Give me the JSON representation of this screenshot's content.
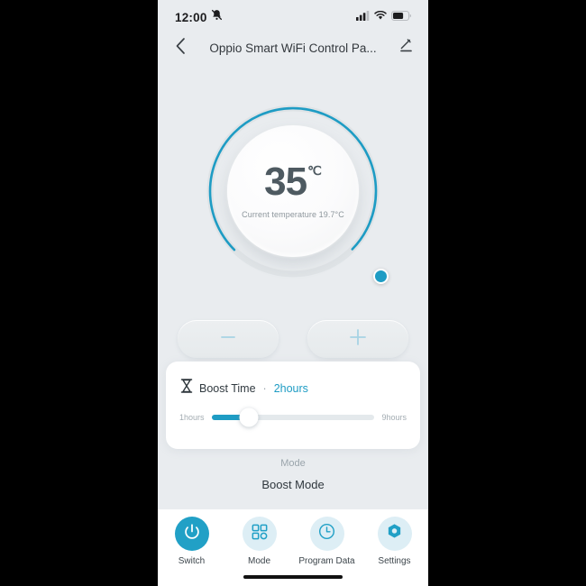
{
  "colors": {
    "accent": "#1e9cc4",
    "nav_active": "#21a0c6",
    "nav_circle": "#ddeef5",
    "background": "#e9ecef",
    "card": "#ffffff",
    "text_dark": "#313a40",
    "text_muted": "#9aa4ab"
  },
  "statusbar": {
    "time": "12:00",
    "mute_icon": "bell-muted-icon",
    "signal_icon": "cellular-signal-icon",
    "wifi_icon": "wifi-icon",
    "battery_icon": "battery-icon",
    "battery_level": 60
  },
  "header": {
    "back_icon": "chevron-left-icon",
    "title": "Oppio Smart WiFi Control Pa...",
    "edit_icon": "pencil-edit-icon"
  },
  "dial": {
    "target_temperature": "35",
    "unit": "℃",
    "current_temperature_text": "Current temperature 19.7°C",
    "arc_start_deg": 135,
    "arc_sweep_deg": 252,
    "handle_icon": "dial-handle"
  },
  "stepper": {
    "minus_label": "−",
    "minus_icon": "minus-icon",
    "plus_label": "+",
    "plus_icon": "plus-icon"
  },
  "boost": {
    "icon": "hourglass-icon",
    "label": "Boost Time",
    "separator": "·",
    "value": "2hours",
    "slider": {
      "min_label": "1hours",
      "max_label": "9hours",
      "min": 1,
      "max": 9,
      "current": 2,
      "fill_percent": 23
    }
  },
  "mode": {
    "caption": "Mode",
    "value": "Boost Mode"
  },
  "nav": {
    "items": [
      {
        "label": "Switch",
        "icon": "power-icon",
        "active": true
      },
      {
        "label": "Mode",
        "icon": "grid-squares-icon",
        "active": false
      },
      {
        "label": "Program Data",
        "icon": "clock-icon",
        "active": false
      },
      {
        "label": "Settings",
        "icon": "hexagon-gear-icon",
        "active": false
      }
    ]
  }
}
